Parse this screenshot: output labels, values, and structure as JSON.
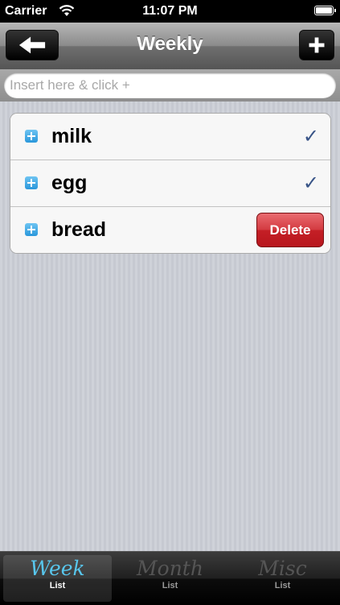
{
  "status_bar": {
    "carrier": "Carrier",
    "time": "11:07 PM"
  },
  "nav": {
    "title": "Weekly",
    "back_icon": "arrow-left-icon",
    "add_icon": "plus-icon"
  },
  "insert": {
    "placeholder": "Insert here & click +",
    "value": ""
  },
  "items": [
    {
      "label": "milk",
      "check": "✓"
    },
    {
      "label": "egg",
      "check": "✓"
    },
    {
      "label": "bread",
      "delete_label": "Delete"
    }
  ],
  "tabs": [
    {
      "script": "Week",
      "label": "List",
      "selected": true
    },
    {
      "script": "Month",
      "label": "List",
      "selected": false
    },
    {
      "script": "Misc",
      "label": "List",
      "selected": false
    }
  ],
  "colors": {
    "accent_tab": "#58c7ee",
    "delete": "#c41f26",
    "check": "#385487"
  }
}
